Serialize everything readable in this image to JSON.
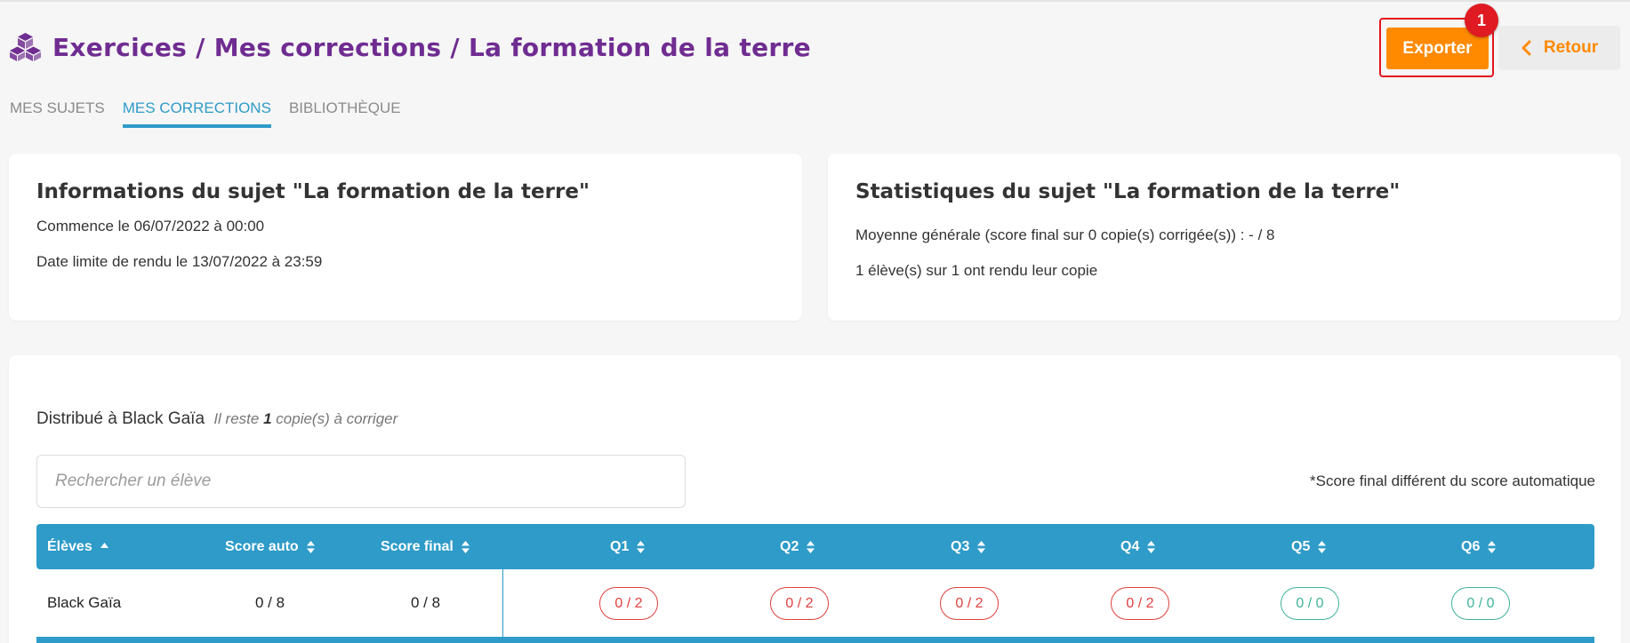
{
  "header": {
    "title": "Exercices / Mes corrections / La formation de la terre",
    "export_label": "Exporter",
    "badge_count": "1",
    "back_label": "Retour"
  },
  "tabs": [
    {
      "label": "MES SUJETS",
      "active": false
    },
    {
      "label": "MES CORRECTIONS",
      "active": true
    },
    {
      "label": "BIBLIOTHÈQUE",
      "active": false
    }
  ],
  "info_card": {
    "title": "Informations du sujet \"La formation de la terre\"",
    "start": "Commence le 06/07/2022 à 00:00",
    "deadline": "Date limite de rendu le  13/07/2022 à 23:59"
  },
  "stats_card": {
    "title": "Statistiques du sujet \"La formation de la terre\"",
    "average": "Moyenne générale (score final sur 0 copie(s) corrigée(s)) : - / 8",
    "submitted": "1 élève(s) sur 1 ont rendu leur copie"
  },
  "main": {
    "distributed": "Distribué à Black Gaïa",
    "remaining_prefix": "Il reste",
    "remaining_count": "1",
    "remaining_suffix": "copie(s) à corriger",
    "search_placeholder": "Rechercher un élève",
    "score_note": "*Score final différent du score automatique"
  },
  "table": {
    "columns": [
      "Élèves",
      "Score auto",
      "Score final",
      "Q1",
      "Q2",
      "Q3",
      "Q4",
      "Q5",
      "Q6"
    ],
    "rows": [
      {
        "student": "Black Gaïa",
        "score_auto": "0 / 8",
        "score_final": "0 / 8",
        "q": [
          "0 / 2",
          "0 / 2",
          "0 / 2",
          "0 / 2",
          "0 / 0",
          "0 / 0"
        ]
      }
    ]
  },
  "colors": {
    "title": "#6f2c91",
    "accent": "#2e9bc8",
    "export": "#ff8a00",
    "badge": "#e01a22",
    "score_red": "#e0403e",
    "score_green": "#3fb39a"
  },
  "icons": {
    "logo": "cubes-icon",
    "back": "chevron-left-icon",
    "sort_asc": "sort-up-icon",
    "sort": "sort-icon"
  }
}
